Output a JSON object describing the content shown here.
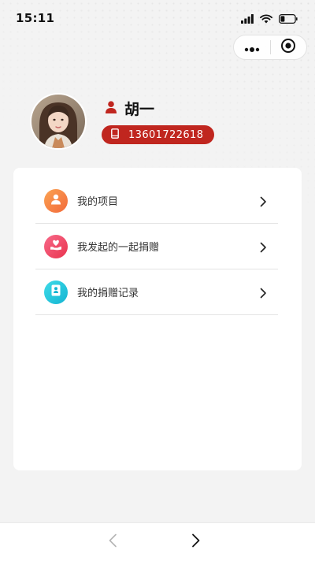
{
  "status_bar": {
    "time": "15:11"
  },
  "profile": {
    "name": "胡一",
    "phone": "13601722618"
  },
  "menu": {
    "items": [
      {
        "label": "我的项目",
        "icon": "user-icon",
        "color": "#f5803e"
      },
      {
        "label": "我发起的一起捐赠",
        "icon": "heart-hand-icon",
        "color": "#ee4d6b"
      },
      {
        "label": "我的捐赠记录",
        "icon": "record-icon",
        "color": "#22c4d9"
      }
    ]
  },
  "colors": {
    "accent_red": "#c0261f",
    "background": "#f3f3f3",
    "card": "#ffffff"
  }
}
